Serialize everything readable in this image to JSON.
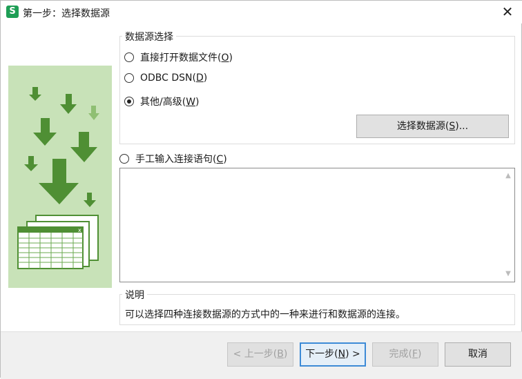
{
  "window": {
    "app_icon_letter": "S",
    "title": "第一步：选择数据源",
    "close_glyph": "✕"
  },
  "datasource_group": {
    "legend": "数据源选择",
    "options": [
      {
        "label": "直接打开数据文件(",
        "key": "O",
        "suffix": ")",
        "checked": false
      },
      {
        "label": "ODBC DSN(",
        "key": "D",
        "suffix": ")",
        "checked": false
      },
      {
        "label": "其他/高级(",
        "key": "W",
        "suffix": ")",
        "checked": true
      }
    ],
    "select_button": {
      "label": "选择数据源(",
      "key": "S",
      "suffix": ")..."
    }
  },
  "manual": {
    "label": "手工输入连接语句(",
    "key": "C",
    "suffix": ")",
    "checked": false,
    "statement_value": ""
  },
  "description": {
    "legend": "说明",
    "text": "可以选择四种连接数据源的方式中的一种来进行和数据源的连接。"
  },
  "footer": {
    "back": {
      "label": "< 上一步(",
      "key": "B",
      "suffix": ")"
    },
    "next": {
      "label": "下一步(",
      "key": "N",
      "suffix": ") >"
    },
    "finish": {
      "label": "完成(",
      "key": "F",
      "suffix": ")"
    },
    "cancel": {
      "label": "取消"
    }
  },
  "colors": {
    "illustration_bg": "#c8e2b8",
    "arrow_dark": "#4f8f34",
    "arrow_light": "#8fbf73",
    "app_icon": "#1e9e55"
  }
}
